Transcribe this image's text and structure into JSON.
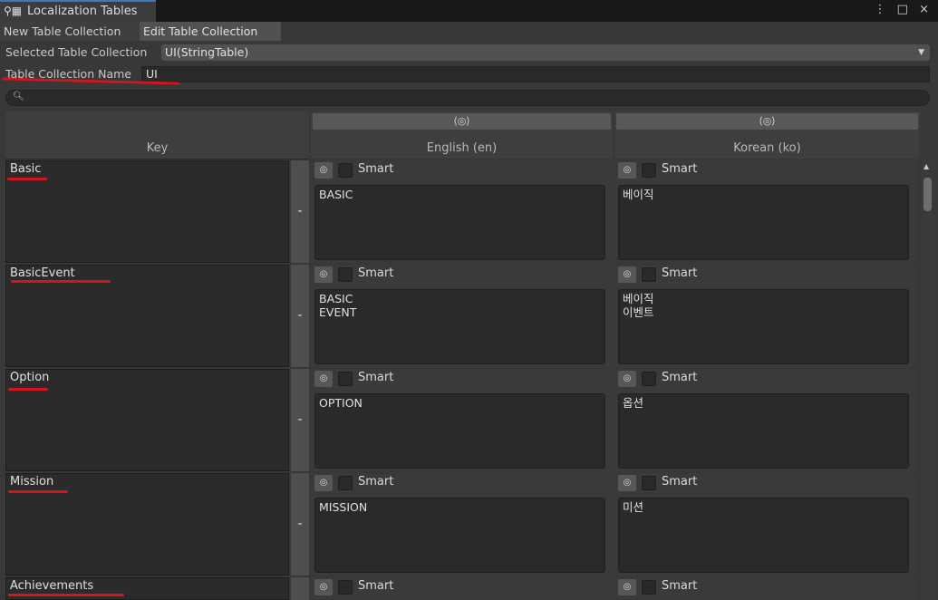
{
  "window": {
    "title": "Localization Tables",
    "controls": "⋮ □ ×"
  },
  "modes": {
    "new": "New Table Collection",
    "edit": "Edit Table Collection"
  },
  "collection": {
    "selected_label": "Selected Table Collection",
    "selected_value": "UI(StringTable)",
    "name_label": "Table Collection Name",
    "name_value": "UI"
  },
  "search": {
    "placeholder": ""
  },
  "table": {
    "key_header": "Key",
    "columns": [
      {
        "name": "English (en)"
      },
      {
        "name": "Korean (ko)"
      }
    ],
    "smart_label": "Smart",
    "remove_label": "-",
    "rows": [
      {
        "key": "Basic",
        "en": "BASIC",
        "ko": "베이직"
      },
      {
        "key": "BasicEvent",
        "en": "BASIC\nEVENT",
        "ko": "베이직\n이벤트"
      },
      {
        "key": "Option",
        "en": "OPTION",
        "ko": "옵션"
      },
      {
        "key": "Mission",
        "en": "MISSION",
        "ko": "미션"
      },
      {
        "key": "Achievements",
        "en": "",
        "ko": ""
      }
    ]
  },
  "annotations": {
    "underline_color": "#d4161c"
  },
  "icons": {
    "tab": "pin-table-icon",
    "locale": "locale-settings-icon",
    "search": "search-icon"
  }
}
